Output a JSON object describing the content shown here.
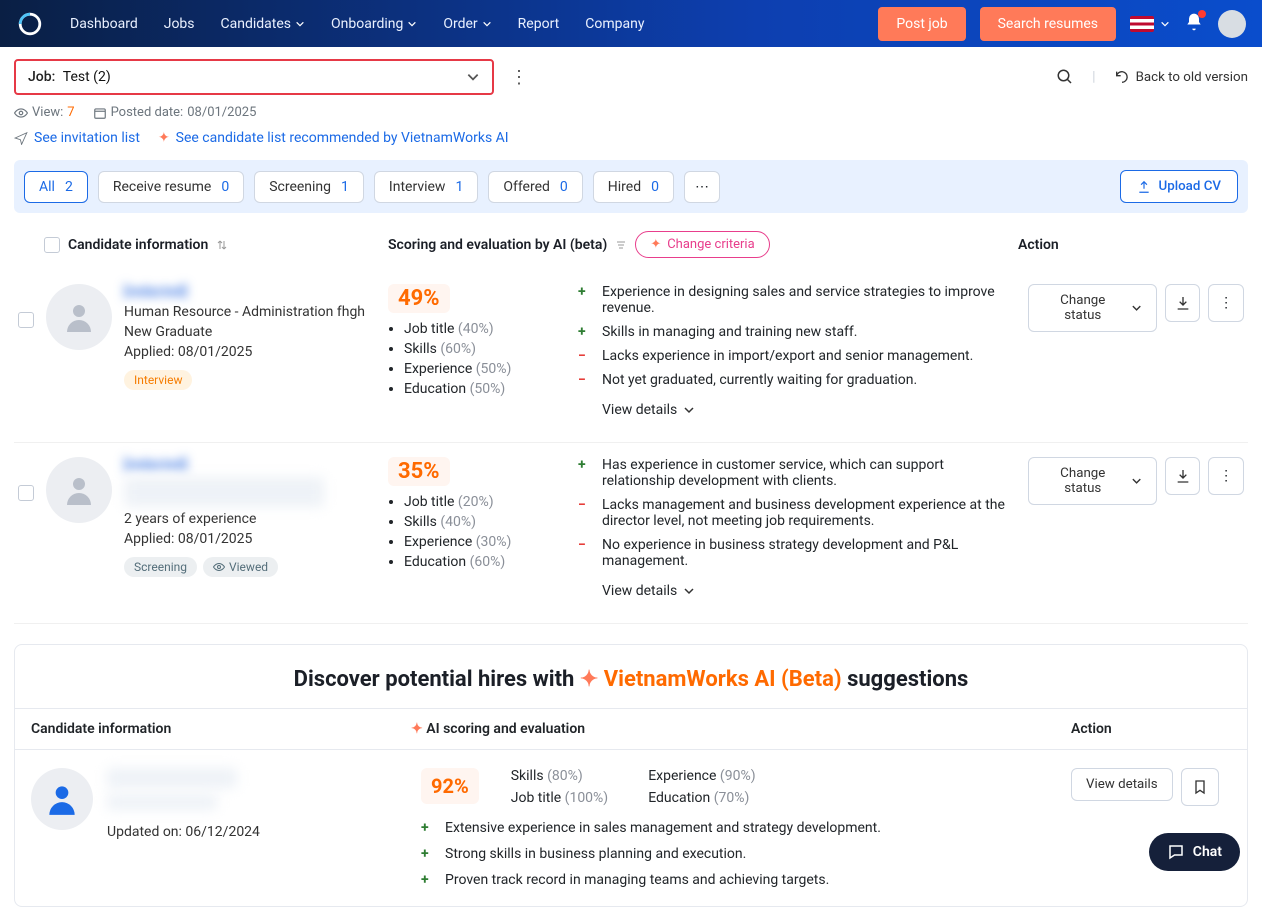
{
  "nav": {
    "dashboard": "Dashboard",
    "jobs": "Jobs",
    "candidates": "Candidates",
    "onboarding": "Onboarding",
    "order": "Order",
    "report": "Report",
    "company": "Company",
    "post": "Post job",
    "search": "Search resumes"
  },
  "back": "Back to old version",
  "job": {
    "label": "Job:",
    "value": "Test (2)"
  },
  "meta": {
    "view_lbl": "View:",
    "view_n": "7",
    "posted_lbl": "Posted date:",
    "posted_v": "08/01/2025"
  },
  "links": {
    "inv": "See invitation list",
    "ai": "See candidate list recommended by VietnamWorks AI"
  },
  "tabs": [
    {
      "l": "All",
      "n": "2",
      "a": true
    },
    {
      "l": "Receive resume",
      "n": "0"
    },
    {
      "l": "Screening",
      "n": "1"
    },
    {
      "l": "Interview",
      "n": "1"
    },
    {
      "l": "Offered",
      "n": "0"
    },
    {
      "l": "Hired",
      "n": "0"
    }
  ],
  "upload": "Upload CV",
  "heads": {
    "c1": "Candidate information",
    "c2": "Scoring and evaluation by AI (beta)",
    "crit": "Change criteria",
    "c3": "Action"
  },
  "c1": {
    "name": "[redacted]",
    "role": "Human Resource - Administration fhgh",
    "exp": "New Graduate",
    "applied_l": "Applied:",
    "applied_v": "08/01/2025",
    "tag": "Interview",
    "score": "49%",
    "b": [
      {
        "k": "Job title",
        "v": "(40%)"
      },
      {
        "k": "Skills",
        "v": "(60%)"
      },
      {
        "k": "Experience",
        "v": "(50%)"
      },
      {
        "k": "Education",
        "v": "(50%)"
      }
    ],
    "pos": [
      "Experience in designing sales and service strategies to improve revenue.",
      "Skills in managing and training new staff."
    ],
    "neg": [
      "Lacks experience in import/export and senior management.",
      "Not yet graduated, currently waiting for graduation."
    ],
    "vd": "View details",
    "cs": "Change status"
  },
  "c2": {
    "name": "[redacted]",
    "exp": "2 years of experience",
    "applied_l": "Applied:",
    "applied_v": "08/01/2025",
    "tags": [
      "Screening",
      "Viewed"
    ],
    "score": "35%",
    "b": [
      {
        "k": "Job title",
        "v": "(20%)"
      },
      {
        "k": "Skills",
        "v": "(40%)"
      },
      {
        "k": "Experience",
        "v": "(30%)"
      },
      {
        "k": "Education",
        "v": "(60%)"
      }
    ],
    "pos": [
      "Has experience in customer service, which can support relationship development with clients."
    ],
    "neg": [
      "Lacks management and business development experience at the director level, not meeting job requirements.",
      "No experience in business strategy development and P&L management."
    ],
    "vd": "View details",
    "cs": "Change status"
  },
  "disc": {
    "title_a": "Discover potential hires with",
    "title_b": "VietnamWorks AI (Beta)",
    "title_c": "suggestions",
    "h1": "Candidate information",
    "h2": "AI scoring and evaluation",
    "h3": "Action",
    "updated_l": "Updated on:",
    "updated_v": "06/12/2024",
    "score": "92%",
    "m": [
      {
        "k": "Skills",
        "v": "(80%)"
      },
      {
        "k": "Experience",
        "v": "(90%)"
      },
      {
        "k": "Job title",
        "v": "(100%)"
      },
      {
        "k": "Education",
        "v": "(70%)"
      }
    ],
    "pos": [
      "Extensive experience in sales management and strategy development.",
      "Strong skills in business planning and execution.",
      "Proven track record in managing teams and achieving targets."
    ],
    "vd": "View details"
  },
  "chat": "Chat"
}
